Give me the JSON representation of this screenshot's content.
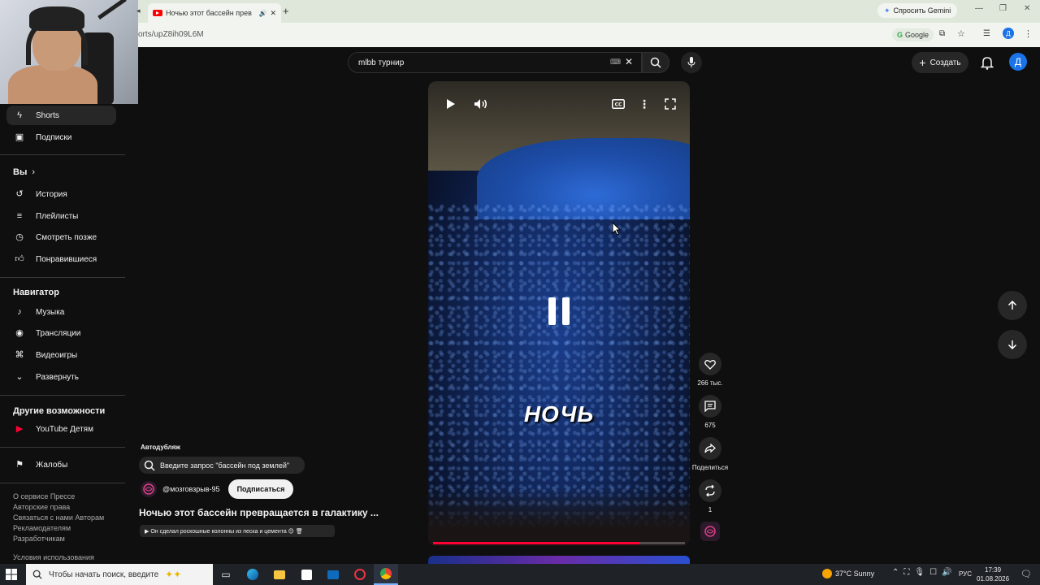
{
  "browser": {
    "tab_title": "Ночью этот бассейн прев",
    "url": "orts/upZ8ih09L6M",
    "gemini_label": "Спросить Gemini",
    "google_chip": "Google",
    "profile_initial": "Д"
  },
  "sidebar": {
    "items_top": [
      {
        "label": "Shorts",
        "icon": "shorts-icon",
        "active": true
      },
      {
        "label": "Подписки",
        "icon": "subscriptions-icon"
      }
    ],
    "you_header": "Вы",
    "you_items": [
      {
        "label": "История",
        "icon": "history-icon"
      },
      {
        "label": "Плейлисты",
        "icon": "playlists-icon"
      },
      {
        "label": "Смотреть позже",
        "icon": "watch-later-icon"
      },
      {
        "label": "Понравившиеся",
        "icon": "liked-icon"
      }
    ],
    "nav_header": "Навигатор",
    "nav_items": [
      {
        "label": "Музыка",
        "icon": "music-icon"
      },
      {
        "label": "Трансляции",
        "icon": "live-icon"
      },
      {
        "label": "Видеоигры",
        "icon": "gaming-icon"
      },
      {
        "label": "Развернуть",
        "icon": "chevron-down-icon"
      }
    ],
    "more_header": "Другие возможности",
    "more_items": [
      {
        "label": "YouTube Детям",
        "icon": "youtube-kids-icon"
      }
    ],
    "report_label": "Жалобы",
    "footer_line1": "О сервисе  Прессе",
    "footer_line2": "Авторские права",
    "footer_line3": "Связаться с нами  Авторам",
    "footer_line4": "Рекламодателям",
    "footer_line5": "Разработчикам",
    "footer_terms": "Условия использования"
  },
  "header": {
    "search_value": "mlbb турнир",
    "create_label": "Создать",
    "avatar_initial": "Д"
  },
  "video": {
    "caption": "НОЧЬ",
    "progress": 0.82,
    "autodub": "Автодубляж",
    "suggest_query": "Введите запрос \"бассейн под землей\"",
    "channel": "@мозговзрыв-95",
    "subscribe_label": "Подписаться",
    "title": "Ночью этот бассейн превращается в галактику ...",
    "description": "▶ Он сделал роскошные колонны из песка и цемента 😊 🗑"
  },
  "actions": {
    "likes": "266 тыс.",
    "comments": "675",
    "share_label": "Поделиться",
    "remix_count": "1"
  },
  "taskbar": {
    "search_placeholder": "Чтобы начать поиск, введите",
    "weather": "37°C  Sunny",
    "lang": "РУС",
    "time": "17:39",
    "date": "01.08.2026"
  },
  "colors": {
    "accent_red": "#ff0033",
    "background": "#0f0f0f",
    "avatar_blue": "#1a73e8"
  }
}
